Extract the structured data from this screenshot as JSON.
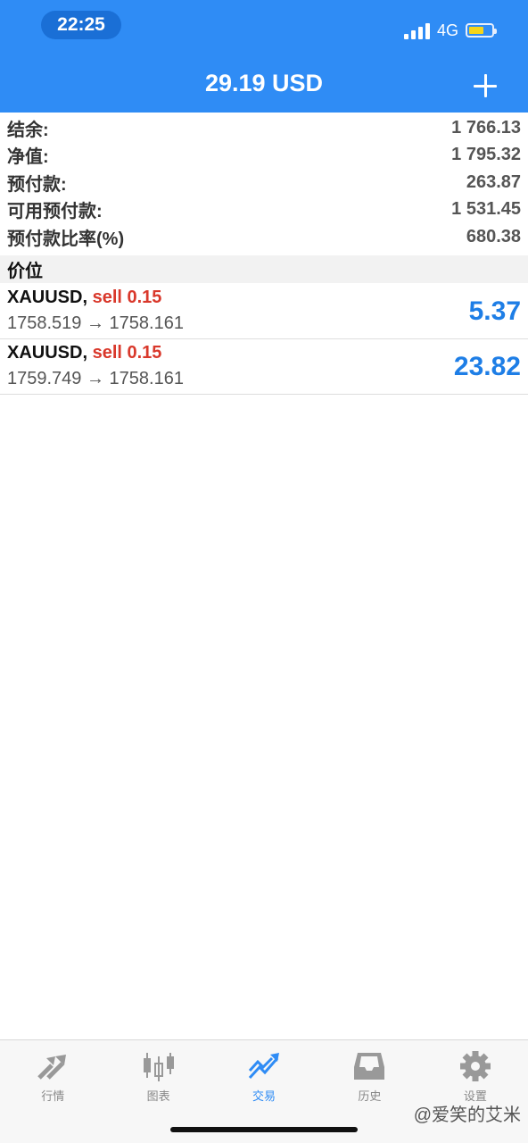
{
  "status_bar": {
    "time": "22:25",
    "network": "4G",
    "battery_color": "#f5d51b"
  },
  "header": {
    "title": "29.19 USD",
    "add_icon": "plus-icon",
    "background": "#2f8cf5"
  },
  "summary": [
    {
      "label": "结余:",
      "value": "1 766.13"
    },
    {
      "label": "净值:",
      "value": "1 795.32"
    },
    {
      "label": "预付款:",
      "value": "263.87"
    },
    {
      "label": "可用预付款:",
      "value": "1 531.45"
    },
    {
      "label": "预付款比率(%)",
      "value": "680.38"
    }
  ],
  "positions_section": {
    "title": "价位"
  },
  "positions": [
    {
      "symbol": "XAUUSD,",
      "side": "sell 0.15",
      "prices": "1758.519 → 1758.161",
      "profit": "5.37"
    },
    {
      "symbol": "XAUUSD,",
      "side": "sell 0.15",
      "prices": "1759.749 → 1758.161",
      "profit": "23.82"
    }
  ],
  "tabs": [
    {
      "label": "行情",
      "icon": "quotes-arrows-icon",
      "active": false
    },
    {
      "label": "图表",
      "icon": "candlestick-chart-icon",
      "active": false
    },
    {
      "label": "交易",
      "icon": "trade-trend-icon",
      "active": true
    },
    {
      "label": "历史",
      "icon": "history-inbox-icon",
      "active": false
    },
    {
      "label": "设置",
      "icon": "gear-icon",
      "active": false
    }
  ],
  "watermark": "@爱笑的艾米",
  "colors": {
    "accent": "#2f8cf5",
    "sell": "#d9382b",
    "profit": "#1e7ee6"
  }
}
